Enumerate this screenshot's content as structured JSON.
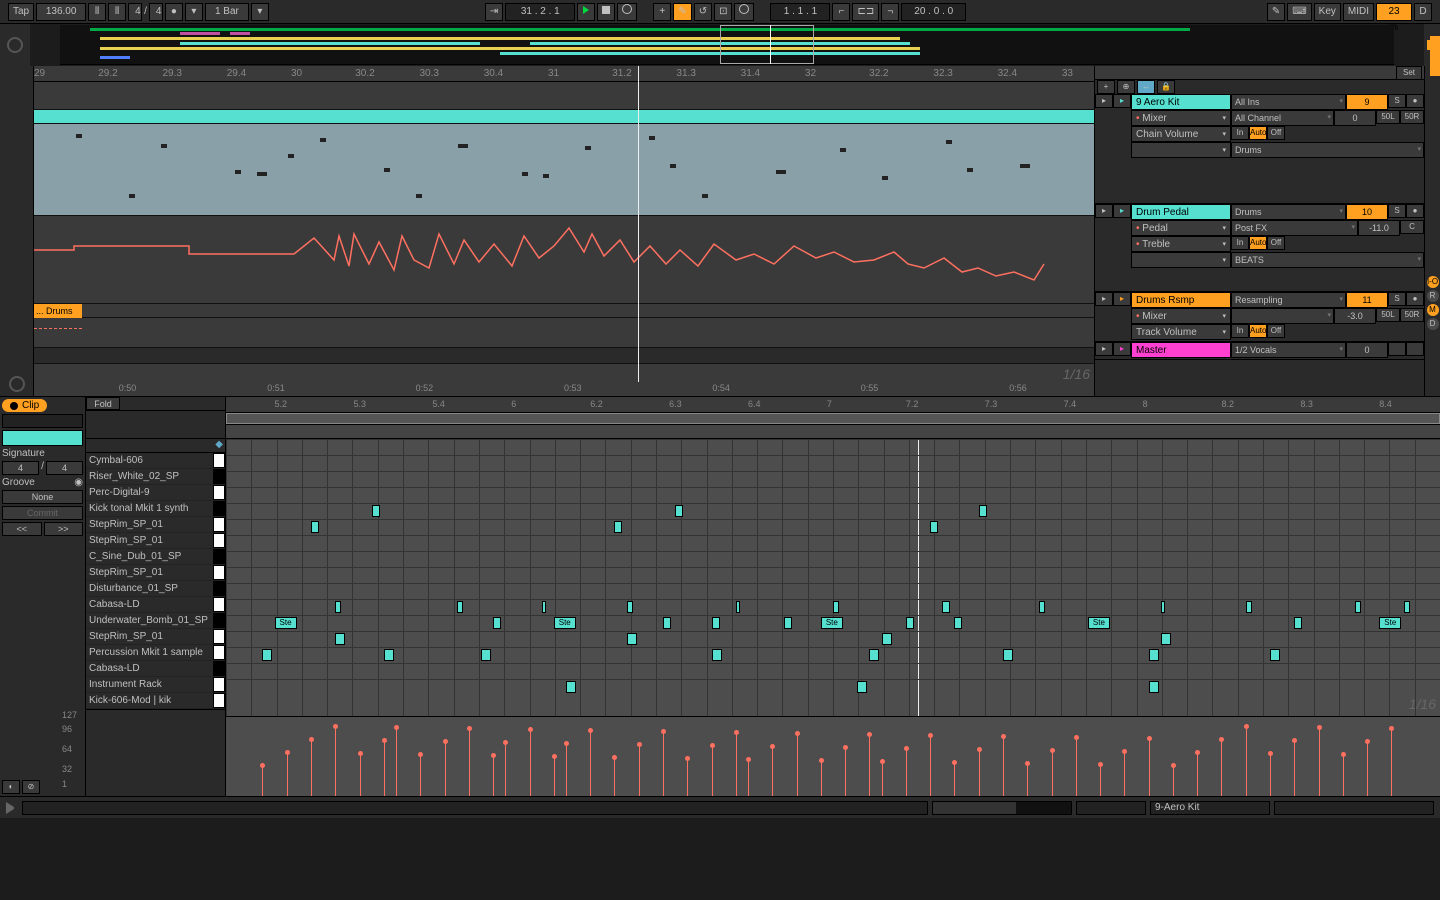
{
  "transport": {
    "tap": "Tap",
    "tempo": "136.00",
    "sig_num": "4",
    "sig_slash": "/",
    "sig_den": "4",
    "quantize": "1 Bar",
    "position": "31 . 2 . 1",
    "loop_start": "1 . 1 . 1",
    "loop_len": "20 . 0 . 0",
    "key": "Key",
    "midi": "MIDI",
    "cpu": "23 %",
    "overload": "D"
  },
  "arrange_ruler": [
    "29",
    "29.2",
    "29.3",
    "29.4",
    "30",
    "30.2",
    "30.3",
    "30.4",
    "31",
    "31.2",
    "31.3",
    "31.4",
    "32",
    "32.2",
    "32.3",
    "32.4",
    "33"
  ],
  "time_ruler": [
    "0:50",
    "0:51",
    "0:52",
    "0:53",
    "0:54",
    "0:55",
    "0:56"
  ],
  "arrange_zoom": "1/16",
  "set_label": "Set",
  "tracks": [
    {
      "name": "9 Aero Kit",
      "color": "#55e0d0",
      "rows": [
        {
          "a": "Mixer",
          "b": "All Channel",
          "n": "0",
          "p1": "50L",
          "p2": "50R"
        },
        {
          "a": "Chain Volume",
          "b_in": "In",
          "b_auto": "Auto",
          "b_off": "Off"
        },
        {
          "a": "",
          "b": "Drums"
        }
      ],
      "route": "All Ins",
      "num": "9",
      "num_col": "orange",
      "s": "S",
      "rec": "●"
    },
    {
      "name": "Drum Pedal",
      "color": "#55e0d0",
      "rows": [
        {
          "a": "Pedal",
          "b": "Post FX",
          "n": "-11.0",
          "p1": "C"
        },
        {
          "a": "Treble",
          "b_in": "In",
          "b_auto": "Auto",
          "b_off": "Off"
        },
        {
          "a": "",
          "b": "BEATS"
        }
      ],
      "route": "Drums",
      "num": "10",
      "num_col": "orange",
      "s": "S",
      "rec": "●"
    },
    {
      "name": "Drums Rsmp",
      "color": "#ffa020",
      "rows": [
        {
          "a": "Mixer",
          "b": "",
          "n": "-3.0",
          "p1": "50L",
          "p2": "50R"
        },
        {
          "a": "Track Volume",
          "b_in": "In",
          "b_auto": "Auto",
          "b_off": "Off"
        }
      ],
      "route": "Resampling",
      "num": "11",
      "num_col": "orange",
      "s": "S",
      "rec": "●"
    },
    {
      "name": "Master",
      "color": "#ff40d0",
      "rows": [],
      "route": "1/2 Vocals",
      "num": "0",
      "num_col": "",
      "s": "",
      "p1": "0"
    }
  ],
  "arrange_clip_label": "... Drums R",
  "clip_panel": {
    "tab": "Clip",
    "fold": "Fold",
    "signature_label": "Signature",
    "sig_num": "4",
    "sig_slash": "/",
    "sig_den": "4",
    "groove_label": "Groove",
    "groove_val": "None",
    "commit": "Commit",
    "nudge_l": "<<",
    "nudge_r": ">>",
    "zoom": "1/16"
  },
  "lanes": [
    {
      "name": "Cymbal-606",
      "key": "w"
    },
    {
      "name": "Riser_White_02_SP",
      "key": "b"
    },
    {
      "name": "Perc-Digital-9",
      "key": "w"
    },
    {
      "name": "Kick tonal Mkit 1 synth",
      "key": "b"
    },
    {
      "name": "StepRim_SP_01",
      "key": "w"
    },
    {
      "name": "StepRim_SP_01",
      "key": "w"
    },
    {
      "name": "C_Sine_Dub_01_SP",
      "key": "b"
    },
    {
      "name": "StepRim_SP_01",
      "key": "w"
    },
    {
      "name": "Disturbance_01_SP",
      "key": "b"
    },
    {
      "name": "Cabasa-LD",
      "key": "w"
    },
    {
      "name": "Underwater_Bomb_01_SP",
      "key": "b"
    },
    {
      "name": "StepRim_SP_01",
      "key": "w"
    },
    {
      "name": "Percussion Mkit 1 sample",
      "key": "w"
    },
    {
      "name": "Cabasa-LD",
      "key": "b"
    },
    {
      "name": "Instrument Rack",
      "key": "w"
    },
    {
      "name": "Kick-606-Mod | kik",
      "key": "w"
    }
  ],
  "clip_ruler": [
    "5.2",
    "5.3",
    "5.4",
    "6",
    "6.2",
    "6.3",
    "6.4",
    "7",
    "7.2",
    "7.3",
    "7.4",
    "8",
    "8.2",
    "8.3",
    "8.4"
  ],
  "note_label": "Ste",
  "velocity_labels": [
    "127",
    "96",
    "64",
    "32",
    "1"
  ],
  "status": {
    "device": "9-Aero Kit"
  },
  "edge_labels": [
    "I-O",
    "R",
    "M",
    "D"
  ],
  "monitor": {
    "in": "In",
    "auto": "Auto",
    "off": "Off"
  }
}
